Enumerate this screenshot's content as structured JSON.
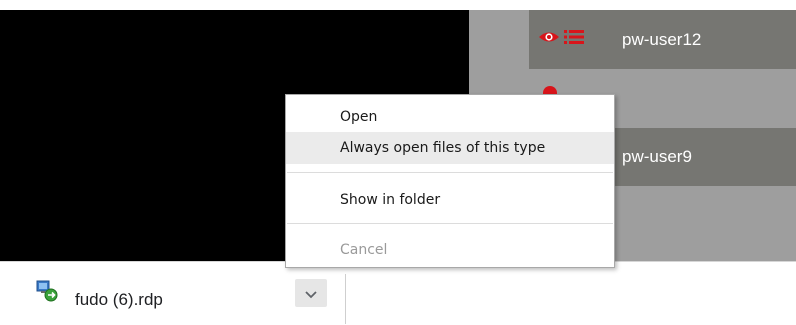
{
  "background": {
    "users": [
      {
        "name": "pw-user12"
      },
      {
        "name": "pw-user9"
      }
    ],
    "row_icons": [
      "eye-icon",
      "list-icon"
    ],
    "colors": {
      "row_bg": "#767672",
      "accent_red": "#d8141a"
    }
  },
  "context_menu": {
    "items": [
      {
        "label": "Open",
        "enabled": true
      },
      {
        "label": "Always open files of this type",
        "enabled": true,
        "highlighted": true
      },
      {
        "label": "Show in folder",
        "enabled": true
      },
      {
        "label": "Cancel",
        "enabled": false
      }
    ]
  },
  "download_bar": {
    "item": {
      "file_name": "fudo (6).rdp",
      "icon": "rdp-file-icon",
      "menu_button_icon": "chevron-down-icon"
    }
  }
}
